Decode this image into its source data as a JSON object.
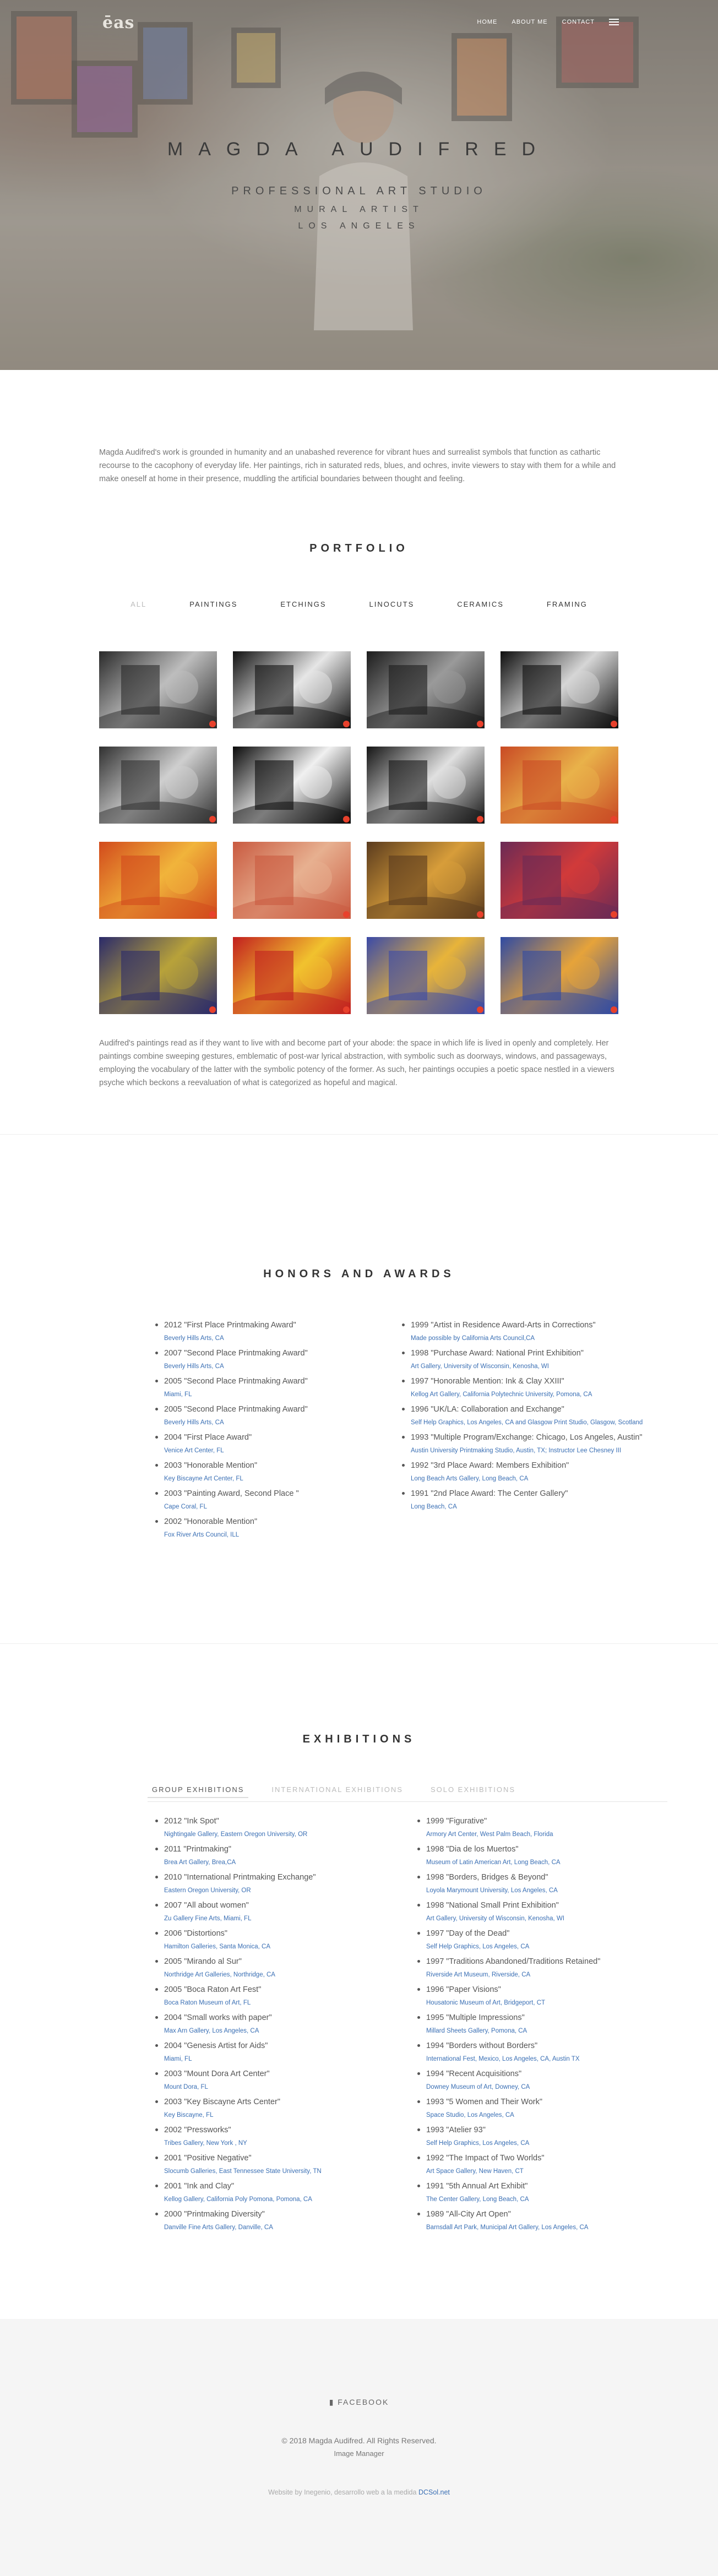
{
  "header": {
    "logo": "ēas",
    "nav": [
      "HOME",
      "ABOUT ME",
      "CONTACT"
    ]
  },
  "hero": {
    "title": "MAGDA AUDIFRED",
    "subtitle": "PROFESSIONAL ART STUDIO",
    "line2": "MURAL ARTIST",
    "line3": "LOS ANGELES"
  },
  "intro": "Magda Audifred's work is grounded in humanity and an unabashed reverence for vibrant hues and surrealist symbols that function as cathartic recourse to the cacophony of everyday life. Her paintings, rich in saturated reds, blues, and ochres, invite viewers to stay with them for a while and make oneself at home in their presence, muddling the artificial boundaries between thought and feeling.",
  "portfolio": {
    "title": "PORTFOLIO",
    "filters": [
      "ALL",
      "PAINTINGS",
      "ETCHINGS",
      "LINOCUTS",
      "CERAMICS",
      "FRAMING"
    ],
    "active_filter": "ALL",
    "paragraph": "Audifred's paintings read as if they want to live with and become part of your abode: the space in which life is lived in openly and completely. Her paintings combine sweeping gestures, emblematic of post-war lyrical abstraction, with symbolic such as doorways, windows, and passageways, employing the vocabulary of the latter with the symbolic potency of the former. As such, her paintings occupies a poetic space nestled in a viewers psyche which beckons a reevaluation of what is categorized as hopeful and magical."
  },
  "honors": {
    "title": "HONORS AND AWARDS",
    "left": [
      {
        "t": "2012 \"First Place Printmaking Award\"",
        "p": "Beverly Hills Arts, CA"
      },
      {
        "t": "2007 \"Second Place Printmaking Award\"",
        "p": "Beverly Hills Arts, CA"
      },
      {
        "t": "2005 \"Second Place Printmaking Award\"",
        "p": "Miami, FL"
      },
      {
        "t": "2005 \"Second Place Printmaking Award\"",
        "p": "Beverly Hills Arts, CA"
      },
      {
        "t": "2004 \"First Place Award\"",
        "p": "Venice Art Center, FL"
      },
      {
        "t": "2003 \"Honorable Mention\"",
        "p": "Key Biscayne Art Center, FL"
      },
      {
        "t": "2003 \"Painting Award, Second Place \"",
        "p": "Cape Coral, FL"
      },
      {
        "t": "2002 \"Honorable Mention\"",
        "p": "Fox River Arts Council, ILL"
      }
    ],
    "right": [
      {
        "t": "1999 \"Artist in Residence Award-Arts in Corrections\"",
        "p": "Made possible by California Arts Council,CA"
      },
      {
        "t": "1998 \"Purchase Award: National Print Exhibition\"",
        "p": "Art Gallery, University of Wisconsin, Kenosha, WI"
      },
      {
        "t": "1997 \"Honorable Mention: Ink & Clay XXIII\"",
        "p": "Kellog Art Gallery, California Polytechnic University, Pomona, CA"
      },
      {
        "t": "1996 \"UK/LA: Collaboration and Exchange\"",
        "p": "Self Help Graphics, Los Angeles, CA and Glasgow Print Studio, Glasgow, Scotland"
      },
      {
        "t": "1993 \"Multiple Program/Exchange: Chicago, Los Angeles, Austin\"",
        "p": "Austin University Printmaking Studio, Austin, TX; Instructor Lee Chesney III"
      },
      {
        "t": "1992 \"3rd Place Award: Members Exhibition\"",
        "p": "Long Beach Arts Gallery, Long Beach, CA"
      },
      {
        "t": "1991 \"2nd Place Award: The Center Gallery\"",
        "p": "Long Beach, CA"
      }
    ]
  },
  "exhibitions": {
    "title": "EXHIBITIONS",
    "tabs": [
      "GROUP EXHIBITIONS",
      "INTERNATIONAL EXHIBITIONS",
      "SOLO EXHIBITIONS"
    ],
    "active_tab": "GROUP EXHIBITIONS",
    "left": [
      {
        "t": "2012 \"Ink Spot\"",
        "p": "Nightingale Gallery, Eastern Oregon University, OR"
      },
      {
        "t": "2011 \"Printmaking\"",
        "p": "Brea Art Gallery, Brea,CA"
      },
      {
        "t": "2010 \"International Printmaking Exchange\"",
        "p": "Eastern Oregon University, OR"
      },
      {
        "t": "2007 \"All about women\"",
        "p": "Zu Gallery Fine Arts, Miami, FL"
      },
      {
        "t": "2006 \"Distortions\"",
        "p": "Hamilton Galleries, Santa Monica, CA"
      },
      {
        "t": "2005 \"Mirando al Sur\"",
        "p": "Northridge Art Galleries, Northridge, CA"
      },
      {
        "t": "2005 \"Boca Raton Art Fest\"",
        "p": "Boca Raton Museum of Art, FL"
      },
      {
        "t": "2004 \"Small works with paper\"",
        "p": "Max Arn Gallery, Los Angeles, CA"
      },
      {
        "t": "2004 \"Genesis Artist for Aids\"",
        "p": "Miami, FL"
      },
      {
        "t": "2003 \"Mount Dora Art Center\"",
        "p": "Mount Dora, FL"
      },
      {
        "t": "2003 \"Key Biscayne Arts Center\"",
        "p": "Key Biscayne, FL"
      },
      {
        "t": "2002 \"Pressworks\"",
        "p": "Tribes Gallery, New York , NY"
      },
      {
        "t": "2001 \"Positive Negative\"",
        "p": "Slocumb Galleries, East Tennessee State University, TN"
      },
      {
        "t": "2001 \"Ink and Clay\"",
        "p": "Kellog Gallery, California Poly Pomona, Pomona, CA"
      },
      {
        "t": "2000 \"Printmaking Diversity\"",
        "p": "Danville Fine Arts Gallery, Danville, CA"
      }
    ],
    "right": [
      {
        "t": "1999 \"Figurative\"",
        "p": "Armory Art Center, West Palm Beach, Florida"
      },
      {
        "t": "1998 \"Dia de los Muertos\"",
        "p": "Museum of Latin American Art, Long Beach, CA"
      },
      {
        "t": "1998 \"Borders, Bridges & Beyond\"",
        "p": "Loyola Marymount University, Los Angeles, CA"
      },
      {
        "t": "1998 \"National Small Print Exhibition\"",
        "p": "Art Gallery, University of Wisconsin, Kenosha, WI"
      },
      {
        "t": "1997 \"Day of the Dead\"",
        "p": "Self Help Graphics, Los Angeles, CA"
      },
      {
        "t": "1997 \"Traditions Abandoned/Traditions Retained\"",
        "p": "Riverside Art Museum, Riverside, CA"
      },
      {
        "t": "1996 \"Paper Visions\"",
        "p": "Housatonic Museum of Art, Bridgeport, CT"
      },
      {
        "t": "1995 \"Multiple Impressions\"",
        "p": "Millard Sheets Gallery, Pomona, CA"
      },
      {
        "t": "1994 \"Borders without Borders\"",
        "p": "International Fest, Mexico, Los Angeles, CA, Austin TX"
      },
      {
        "t": "1994 \"Recent Acquisitions\"",
        "p": "Downey Museum of Art, Downey, CA"
      },
      {
        "t": "1993 \"5 Women and Their Work\"",
        "p": "Space Studio, Los Angeles, CA"
      },
      {
        "t": "1993 \"Atelier 93\"",
        "p": "Self Help Graphics, Los Angeles, CA"
      },
      {
        "t": "1992 \"The Impact of Two Worlds\"",
        "p": "Art Space Gallery, New Haven, CT"
      },
      {
        "t": "1991 \"5th Annual Art Exhibit\"",
        "p": "The Center Gallery, Long Beach, CA"
      },
      {
        "t": "1989 \"All-City Art Open\"",
        "p": "Barnsdall Art Park, Municipal Art Gallery, Los Angeles, CA"
      }
    ]
  },
  "footer": {
    "facebook": "FACEBOOK",
    "copyright": "© 2018 Magda Audifred. All Rights Reserved.",
    "manager": "Image Manager",
    "credit_prefix": "Website by Inegenio, desarrollo web a la medida ",
    "credit_link": "DCSol.net"
  },
  "colors": {
    "link": "#3a6fb4",
    "accent_dot": "#e8412c",
    "footer_bg": "#f5f5f5"
  },
  "thumbnails": [
    {
      "bg": "#2a2a2a",
      "fg": "#bdbdbd"
    },
    {
      "bg": "#111111",
      "fg": "#e6e6e6"
    },
    {
      "bg": "#1c1c1c",
      "fg": "#9a9a9a"
    },
    {
      "bg": "#0e0e0e",
      "fg": "#d6d6d6"
    },
    {
      "bg": "#303030",
      "fg": "#cfcfcf"
    },
    {
      "bg": "#0a0a0a",
      "fg": "#f0f0f0"
    },
    {
      "bg": "#151515",
      "fg": "#e0e0e0"
    },
    {
      "bg": "#c94a24",
      "fg": "#e9b24a"
    },
    {
      "bg": "#d24a1c",
      "fg": "#f1b43b"
    },
    {
      "bg": "#c95a40",
      "fg": "#e7b090"
    },
    {
      "bg": "#5a3b1e",
      "fg": "#d79d3a"
    },
    {
      "bg": "#6a2a55",
      "fg": "#d13a3a"
    },
    {
      "bg": "#2a2a6a",
      "fg": "#b8a23a"
    },
    {
      "bg": "#c21f1f",
      "fg": "#f1c22e"
    },
    {
      "bg": "#3a4aa8",
      "fg": "#e8b43a"
    },
    {
      "bg": "#2f4aa3",
      "fg": "#e6a33a"
    }
  ]
}
